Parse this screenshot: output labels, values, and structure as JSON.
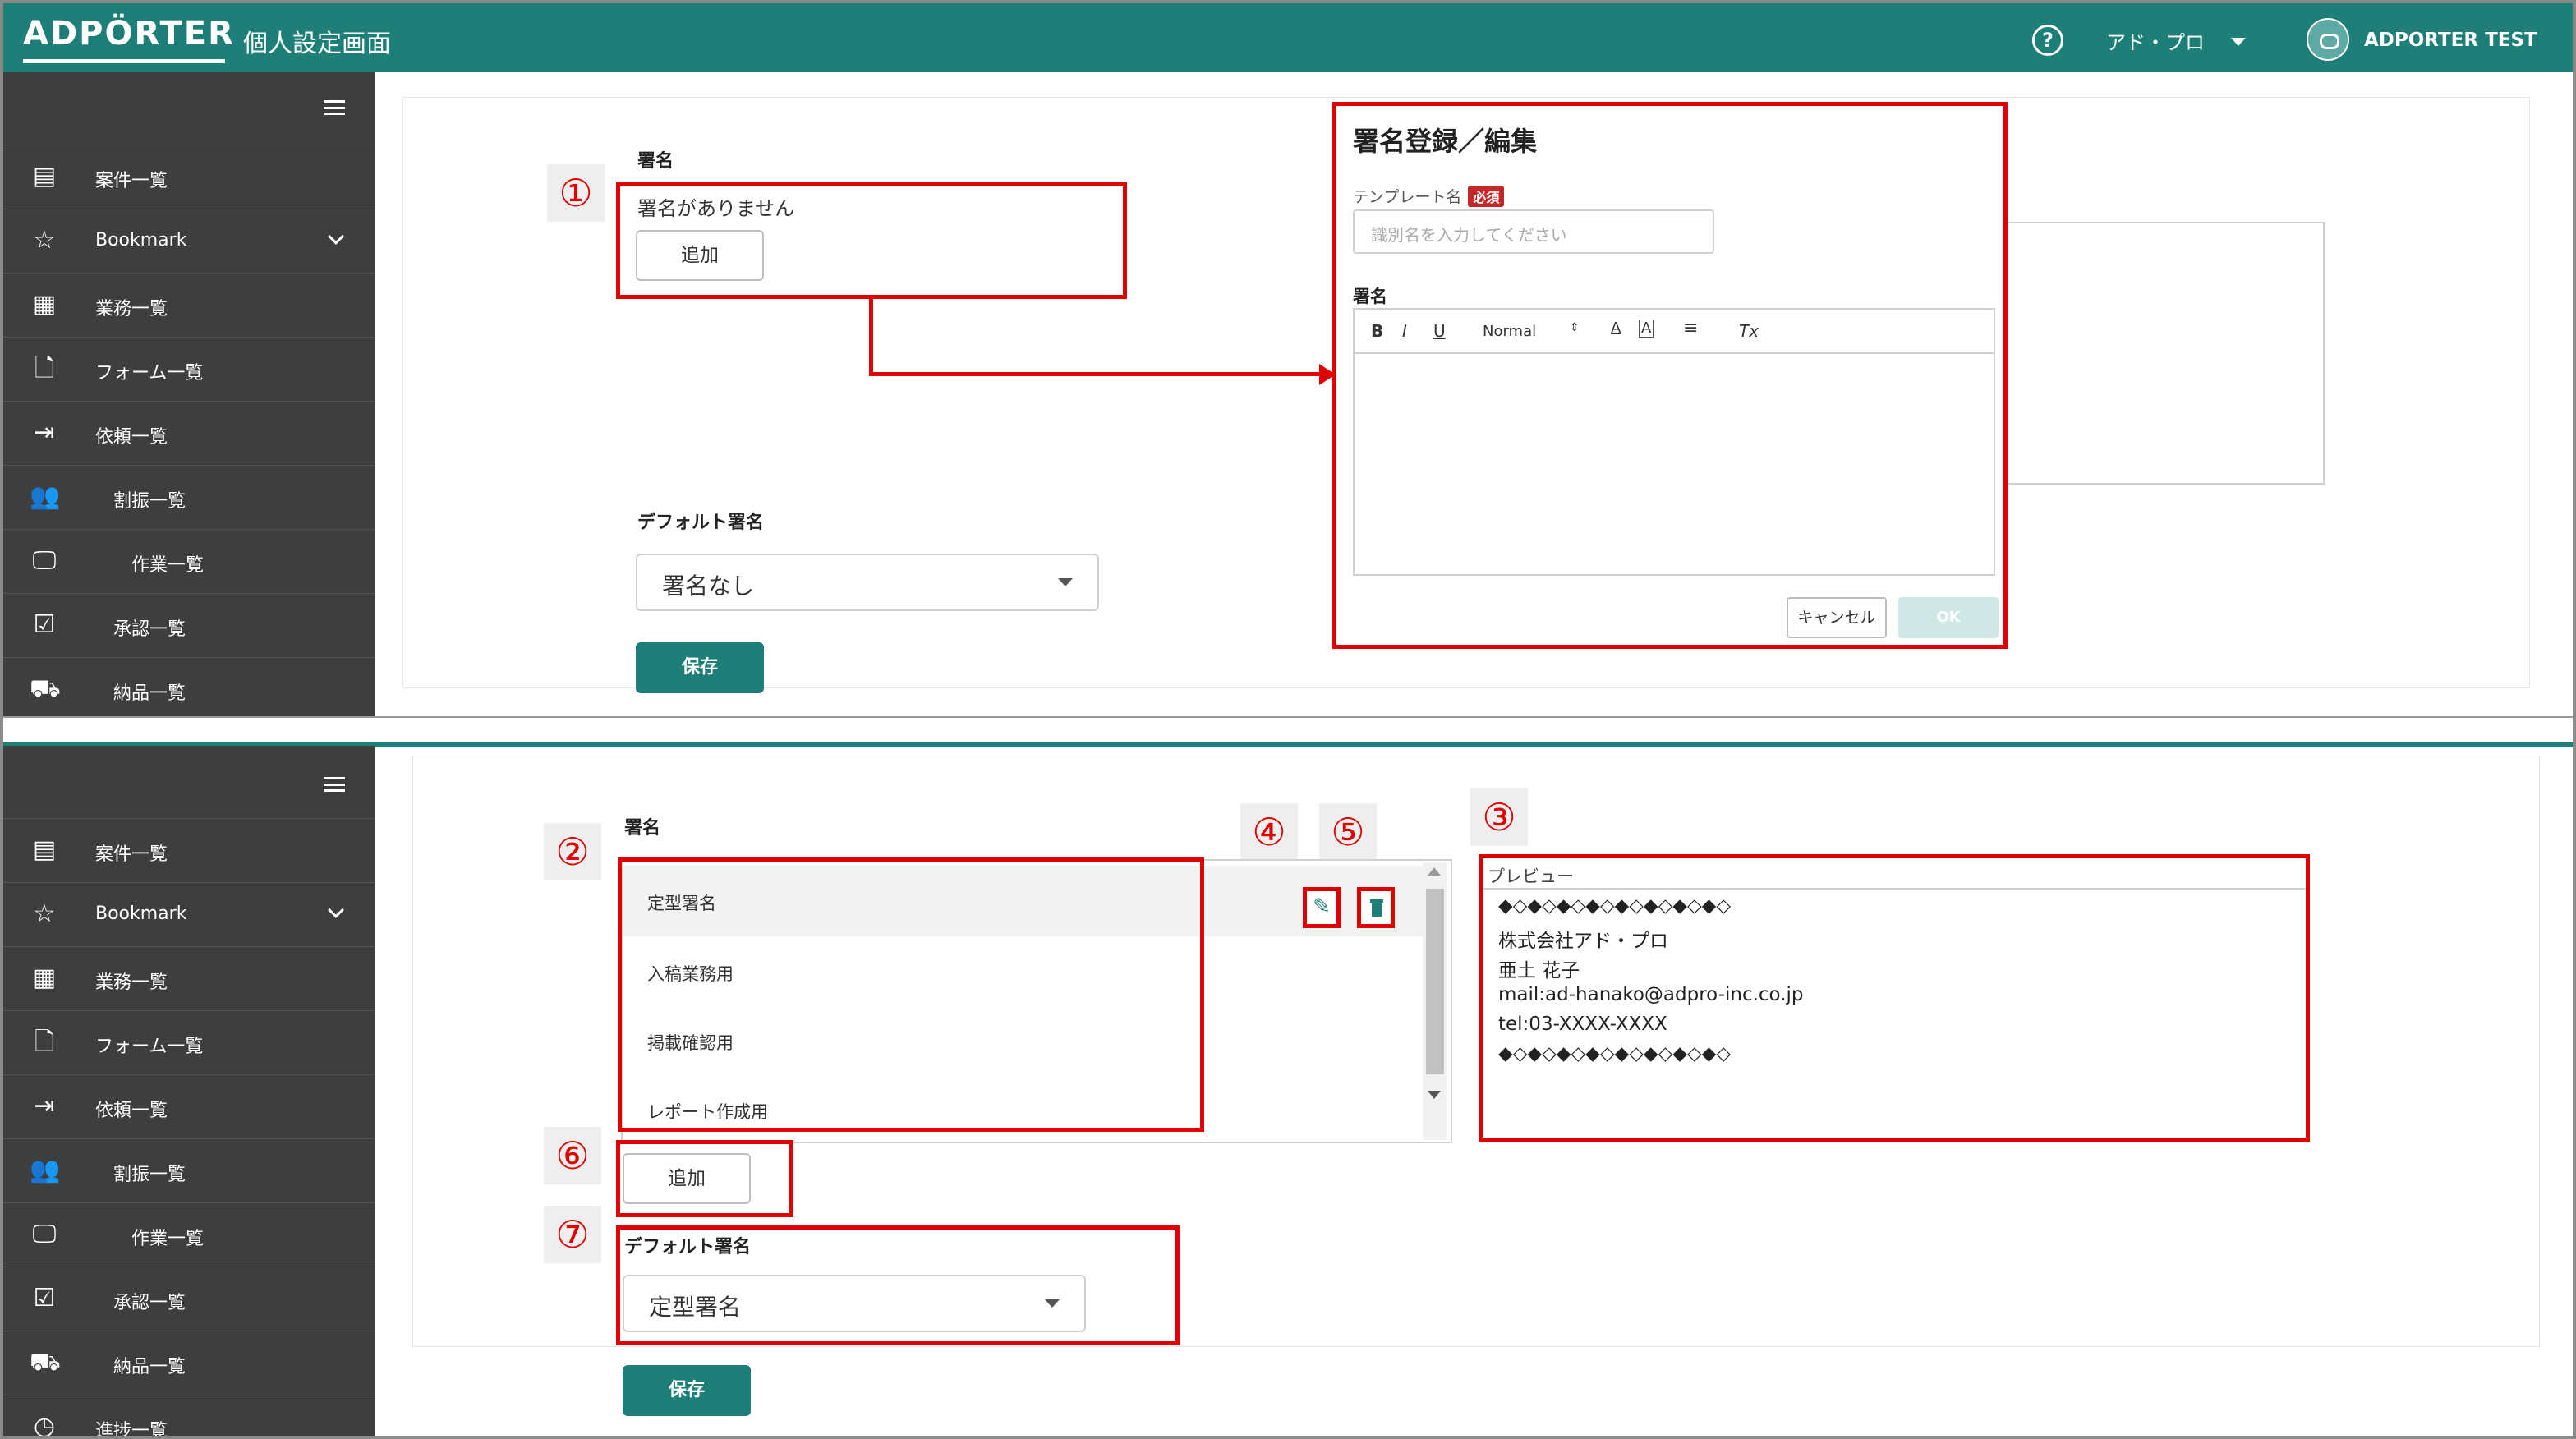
{
  "header": {
    "logo": "ADPÖRTER",
    "title": "個人設定画面",
    "company": "アド・プロ",
    "user": "ADPORTER TEST"
  },
  "sidebar": {
    "items": [
      {
        "label": "案件一覧",
        "icon": "document-icon"
      },
      {
        "label": "Bookmark",
        "icon": "star-icon"
      },
      {
        "label": "業務一覧",
        "icon": "building-icon"
      },
      {
        "label": "フォーム一覧",
        "icon": "file-form-icon"
      },
      {
        "label": "依頼一覧",
        "icon": "login-icon"
      },
      {
        "label": "割振一覧",
        "icon": "people-icon"
      },
      {
        "label": "作業一覧",
        "icon": "monitor-icon"
      },
      {
        "label": "承認一覧",
        "icon": "approve-icon"
      },
      {
        "label": "納品一覧",
        "icon": "truck-icon"
      },
      {
        "label": "進捗一覧",
        "icon": "history-icon"
      }
    ]
  },
  "top": {
    "signature_label": "署名",
    "no_signature": "署名がありません",
    "add_label": "追加",
    "default_label": "デフォルト署名",
    "default_value": "署名なし",
    "save_label": "保存"
  },
  "modal": {
    "title": "署名登録／編集",
    "template_label": "テンプレート名",
    "required": "必須",
    "template_placeholder": "識別名を入力してください",
    "signature_label": "署名",
    "toolbar": {
      "bold": "B",
      "italic": "I",
      "underline": "U",
      "size": "Normal",
      "font_color": "A",
      "bg_color": "A",
      "clear": "Tx"
    },
    "cancel_label": "キャンセル",
    "ok_label": "OK"
  },
  "bottom": {
    "signature_label": "署名",
    "list": [
      "定型署名",
      "入稿業務用",
      "掲載確認用",
      "レポート作成用"
    ],
    "preview_label": "プレビュー",
    "preview_lines": [
      "◆◇◆◇◆◇◆◇◆◇◆◇◆◇◆◇",
      "株式会社アド・プロ",
      "亜土 花子",
      "mail:ad-hanako@adpro-inc.co.jp",
      "tel:03-XXXX-XXXX",
      "◆◇◆◇◆◇◆◇◆◇◆◇◆◇◆◇"
    ],
    "add_label": "追加",
    "default_label": "デフォルト署名",
    "default_value": "定型署名",
    "save_label": "保存"
  },
  "annotations": [
    "①",
    "②",
    "③",
    "④",
    "⑤",
    "⑥",
    "⑦"
  ],
  "colors": {
    "brand": "#1e7f79",
    "sidebar": "#3e3e3e",
    "highlight": "#e00000"
  }
}
